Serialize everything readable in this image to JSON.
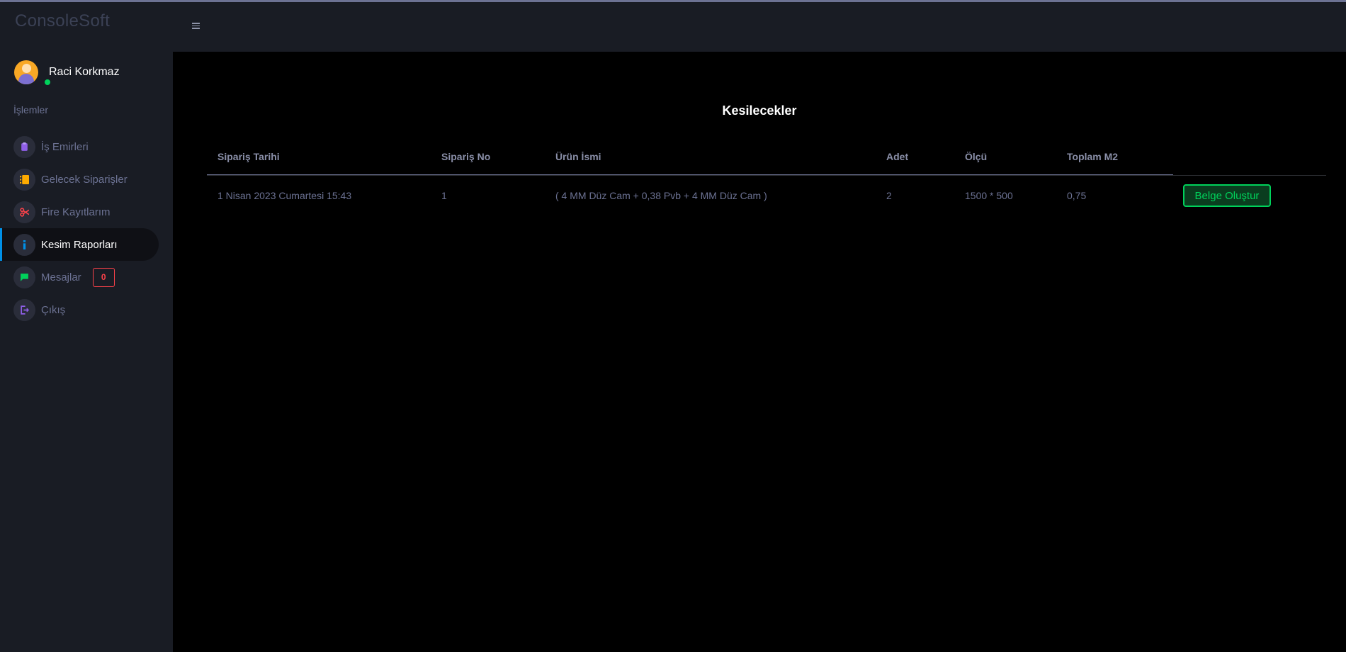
{
  "app": {
    "brand": "ConsoleSoft"
  },
  "user": {
    "name": "Raci Korkmaz"
  },
  "sidebar": {
    "section_label": "İşlemler",
    "items": [
      {
        "label": "İş Emirleri",
        "icon": "clipboard-icon",
        "icon_color": "#8f5fe8"
      },
      {
        "label": "Gelecek Siparişler",
        "icon": "list-icon",
        "icon_color": "#ffab00"
      },
      {
        "label": "Fire Kayıtlarım",
        "icon": "scissors-icon",
        "icon_color": "#fc424a"
      },
      {
        "label": "Kesim Raporları",
        "icon": "info-icon",
        "icon_color": "#0090e7",
        "active": true
      },
      {
        "label": "Mesajlar",
        "icon": "chat-icon",
        "icon_color": "#00d25b",
        "badge": "0"
      },
      {
        "label": "Çıkış",
        "icon": "logout-icon",
        "icon_color": "#8f5fe8"
      }
    ]
  },
  "main": {
    "title": "Kesilecekler",
    "table": {
      "columns": [
        "Sipariş Tarihi",
        "Sipariş No",
        "Ürün İsmi",
        "Adet",
        "Ölçü",
        "Toplam M2"
      ],
      "rows": [
        {
          "date": "1 Nisan 2023 Cumartesi 15:43",
          "order_no": "1",
          "product": "( 4 MM Düz Cam + 0,38 Pvb + 4 MM Düz Cam )",
          "qty": "2",
          "size": "1500 * 500",
          "total_m2": "0,75",
          "action_label": "Belge Oluştur"
        }
      ]
    }
  },
  "colors": {
    "sidebar_bg": "#191c24",
    "main_bg": "#000000",
    "accent_blue": "#0090e7",
    "success": "#00d25b",
    "danger": "#fc424a",
    "muted_text": "#6c7293"
  }
}
